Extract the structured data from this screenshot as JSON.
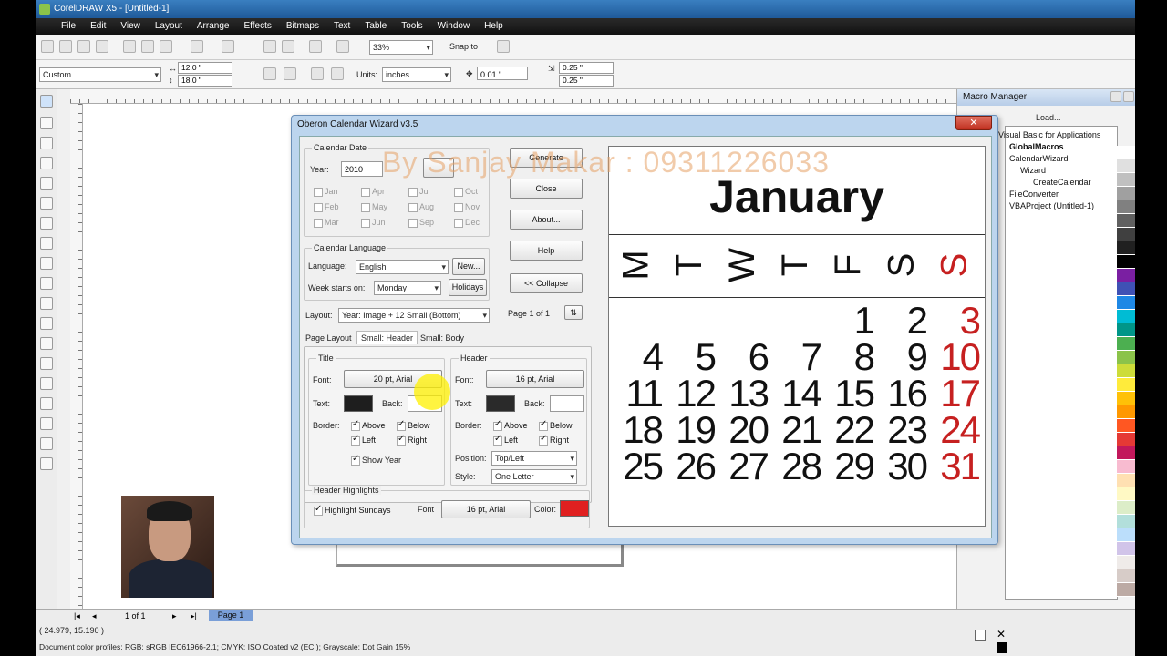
{
  "window": {
    "title": "CorelDRAW X5 - [Untitled-1]"
  },
  "menu": [
    "File",
    "Edit",
    "View",
    "Layout",
    "Arrange",
    "Effects",
    "Bitmaps",
    "Text",
    "Table",
    "Tools",
    "Window",
    "Help"
  ],
  "toolbar": {
    "zoom": "33%",
    "snap_to": "Snap to"
  },
  "propertybar": {
    "paper": "Custom",
    "width": "12.0 \"",
    "height": "18.0 \"",
    "units_label": "Units:",
    "units": "inches",
    "nudge": "0.01 \"",
    "dup_x": "0.25 \"",
    "dup_y": "0.25 \""
  },
  "dialog": {
    "title": "Oberon Calendar Wizard v3.5",
    "close_glyph": "✕",
    "calendar_date": {
      "group_label": "Calendar Date",
      "year_label": "Year:",
      "year_value": "2010",
      "months": [
        "Jan",
        "Apr",
        "Jul",
        "Oct",
        "Feb",
        "May",
        "Aug",
        "Nov",
        "Mar",
        "Jun",
        "Sep",
        "Dec"
      ]
    },
    "buttons": {
      "generate": "Generate",
      "close": "Close",
      "about": "About...",
      "help": "Help",
      "collapse": "<< Collapse",
      "new": "New...",
      "holidays": "Holidays"
    },
    "language": {
      "group_label": "Calendar Language",
      "language_label": "Language:",
      "language_value": "English",
      "week_label": "Week starts on:",
      "week_value": "Monday"
    },
    "layout": {
      "label": "Layout:",
      "value": "Year: Image + 12 Small (Bottom)",
      "page_info": "Page 1 of 1"
    },
    "tabs": [
      "Page Layout",
      "Small: Header",
      "Small: Body"
    ],
    "title_group": {
      "group_label": "Title",
      "font_label": "Font:",
      "font_value": "20 pt, Arial",
      "text_label": "Text:",
      "back_label": "Back:",
      "border_label": "Border:",
      "above": "Above",
      "below": "Below",
      "left": "Left",
      "right": "Right",
      "show_year": "Show Year",
      "text_color": "#1e1e1e"
    },
    "header_group": {
      "group_label": "Header",
      "font_label": "Font:",
      "font_value": "16 pt, Arial",
      "text_label": "Text:",
      "back_label": "Back:",
      "border_label": "Border:",
      "above": "Above",
      "below": "Below",
      "left": "Left",
      "right": "Right",
      "position_label": "Position:",
      "position_value": "Top/Left",
      "style_label": "Style:",
      "style_value": "One Letter",
      "text_color": "#2a2a2a"
    },
    "highlights": {
      "group_label": "Header Highlights",
      "highlight_sundays": "Highlight Sundays",
      "font_label": "Font",
      "font_value": "16 pt, Arial",
      "color_label": "Color:",
      "color": "#e02020"
    },
    "preview": {
      "month": "January",
      "days": [
        "M",
        "T",
        "W",
        "T",
        "F",
        "S",
        "S"
      ],
      "weeks": [
        [
          "",
          "",
          "",
          "",
          "1",
          "2",
          "3"
        ],
        [
          "4",
          "5",
          "6",
          "7",
          "8",
          "9",
          "10"
        ],
        [
          "11",
          "12",
          "13",
          "14",
          "15",
          "16",
          "17"
        ],
        [
          "18",
          "19",
          "20",
          "21",
          "22",
          "23",
          "24"
        ],
        [
          "25",
          "26",
          "27",
          "28",
          "29",
          "30",
          "31"
        ]
      ],
      "sunday_color": "#c62020"
    }
  },
  "watermark": "By Sanjay Makar : 09311226033",
  "macro_manager": {
    "title": "Macro Manager",
    "load": "Load...",
    "tree": [
      "Visual Basic for Applications",
      "GlobalMacros",
      "CalendarWizard",
      "Wizard",
      "CreateCalendar",
      "FileConverter",
      "VBAProject (Untitled-1)"
    ]
  },
  "status": {
    "page_of": "1 of 1",
    "page_tab": "Page 1",
    "coords": "( 24.979, 15.190 )",
    "profiles": "Document color profiles: RGB: sRGB IEC61966-2.1; CMYK: ISO Coated v2 (ECI); Grayscale: Dot Gain 15%"
  },
  "palette": [
    "#ffffff",
    "#e0e0e0",
    "#c0c0c0",
    "#a0a0a0",
    "#808080",
    "#606060",
    "#404040",
    "#202020",
    "#000000",
    "#7a1fa2",
    "#3f51b5",
    "#1e88e5",
    "#00bcd4",
    "#009688",
    "#4caf50",
    "#8bc34a",
    "#cddc39",
    "#ffeb3b",
    "#ffc107",
    "#ff9800",
    "#ff5722",
    "#e53935",
    "#c2185b",
    "#f8bbd0",
    "#ffe0b2",
    "#fff9c4",
    "#dcedc8",
    "#b2dfdb",
    "#bbdefb",
    "#d1c4e9",
    "#efebe9",
    "#d7ccc8",
    "#bcaaa4"
  ]
}
